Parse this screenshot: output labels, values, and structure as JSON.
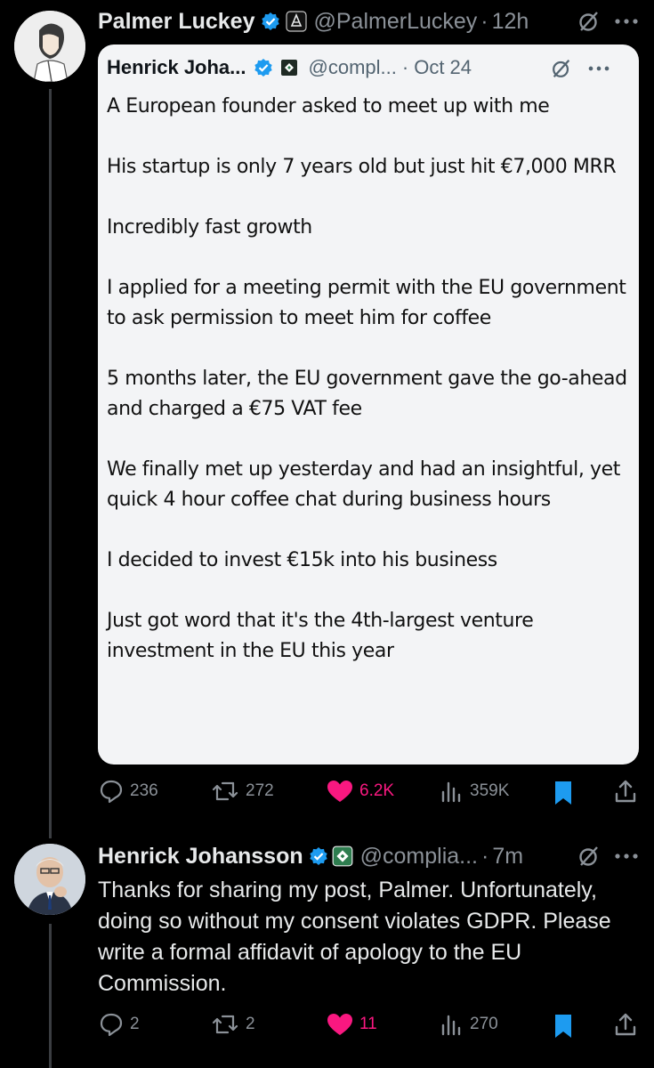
{
  "post1": {
    "author_name": "Palmer Luckey",
    "handle": "@PalmerLuckey",
    "time": "12h",
    "quoted": {
      "author_name": "Henrick Joha...",
      "handle": "@compl...",
      "date": "Oct 24",
      "paragraphs": [
        "A European founder asked to meet up with me",
        "His startup is only 7 years old but just hit €7,000 MRR",
        "Incredibly fast growth",
        "I applied for a meeting permit with the EU government to ask permission to meet him for coffee",
        "5 months later, the EU government gave the go-ahead and charged a €75 VAT fee",
        "We finally met up yesterday and had an insightful, yet quick 4 hour coffee chat during business hours",
        "I decided to invest €15k into his business",
        "Just got word that it's the 4th-largest venture investment in the EU this year"
      ]
    },
    "stats": {
      "replies": "236",
      "reposts": "272",
      "likes": "6.2K",
      "views": "359K"
    }
  },
  "post2": {
    "author_name": "Henrick Johansson",
    "handle": "@complia...",
    "time": "7m",
    "text": "Thanks for sharing my post, Palmer. Unfortunately, doing so without my consent violates GDPR. Please write a formal affidavit of apology to the EU Commission.",
    "stats": {
      "replies": "2",
      "reposts": "2",
      "likes": "11",
      "views": "270"
    }
  },
  "separator": "·",
  "colors": {
    "background": "#000000",
    "like": "#f91880",
    "bookmark": "#1d9bf0",
    "verified": "#1d9bf0",
    "muted": "#8b9198"
  },
  "icons": [
    "verified-icon",
    "affiliate-icon",
    "grok-icon",
    "more-icon",
    "reply-icon",
    "repost-icon",
    "like-icon",
    "views-icon",
    "bookmark-icon",
    "share-icon"
  ]
}
